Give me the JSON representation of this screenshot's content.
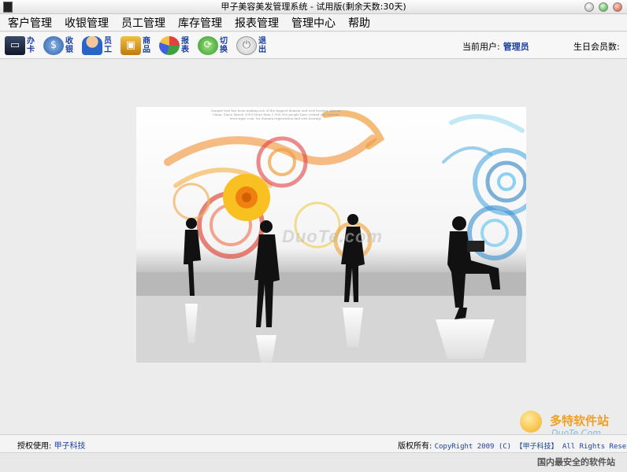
{
  "window": {
    "title": "甲子美容美发管理系统 - 试用版(剩余天数:30天)"
  },
  "menu": {
    "items": [
      "客户管理",
      "收银管理",
      "员工管理",
      "库存管理",
      "报表管理",
      "管理中心",
      "帮助"
    ]
  },
  "toolbar": {
    "buttons": [
      {
        "label": "办卡",
        "icon": "card-icon"
      },
      {
        "label": "收银",
        "icon": "cash-icon"
      },
      {
        "label": "员工",
        "icon": "staff-icon"
      },
      {
        "label": "商品",
        "icon": "goods-icon"
      },
      {
        "label": "报表",
        "icon": "report-icon"
      },
      {
        "label": "切换",
        "icon": "switch-icon"
      },
      {
        "label": "退出",
        "icon": "exit-icon"
      }
    ],
    "current_user_label": "当前用户:",
    "current_user": "管理员",
    "birthday_label": "生日会员数:"
  },
  "banner": {
    "fine_print": "Sample text has been making use of the biggest domain and web hosting sites in China. Since March 1999 More than 1 000 000 people have visited our website www.nipic.com, for domain registration and web hosting.",
    "watermark": "DuoTe.com"
  },
  "footer": {
    "license_label": "授权使用:",
    "license_value": "甲子科技",
    "copyright_label": "版权所有:",
    "copyright_value": "CopyRight 2009 (C) 【甲子科技】 All Rights Reser"
  },
  "corner_watermark": {
    "name": "多特软件站",
    "domain": "DuoTe.Com",
    "slogan": "国内最安全的软件站"
  },
  "colors": {
    "accent_blue": "#1a3fa0",
    "chrome_gray": "#ececec"
  }
}
